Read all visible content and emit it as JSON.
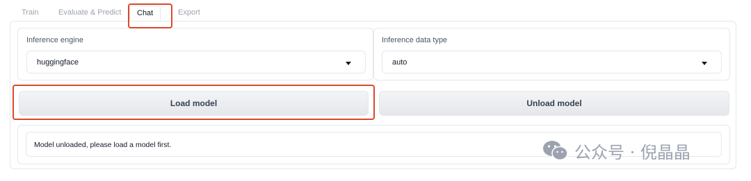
{
  "tabs": [
    {
      "label": "Train"
    },
    {
      "label": "Evaluate & Predict"
    },
    {
      "label": "Chat"
    },
    {
      "label": "Export"
    }
  ],
  "active_tab": "Chat",
  "inference_engine": {
    "label": "Inference engine",
    "value": "huggingface"
  },
  "inference_dtype": {
    "label": "Inference data type",
    "value": "auto"
  },
  "buttons": {
    "load": "Load model",
    "unload": "Unload model"
  },
  "status": {
    "text": "Model unloaded, please load a model first."
  },
  "watermark": {
    "text": "公众号 · 倪晶晶",
    "icon": "wechat-icon"
  },
  "colors": {
    "highlight": "#d9482b",
    "button_bg": "#e5e7eb"
  }
}
